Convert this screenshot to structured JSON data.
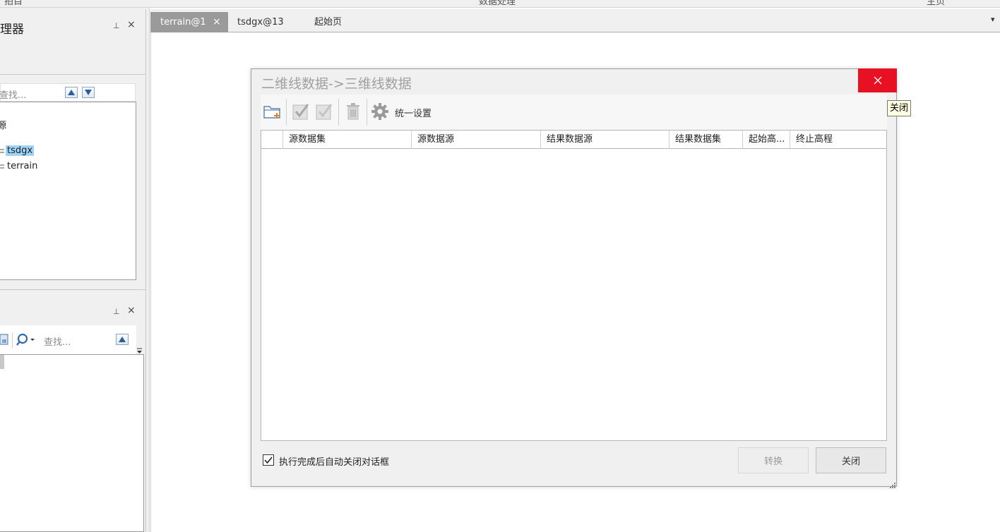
{
  "top_strip": {
    "left_text": "拍目",
    "center_text": "数据处理",
    "right_text": "主页"
  },
  "workspace_panel": {
    "title": "理器",
    "pin_glyph": "⊥",
    "close_glyph": "×",
    "search_placeholder": "查找...",
    "tree": [
      {
        "label": "源",
        "selected": false
      },
      {
        "label": "tsdgx",
        "selected": true
      },
      {
        "label": "terrain",
        "selected": false
      }
    ]
  },
  "layer_panel": {
    "pin_glyph": "⊥",
    "close_glyph": "×",
    "search_placeholder": "查找..."
  },
  "tabs": [
    {
      "label": "terrain@1",
      "active": true,
      "close_glyph": "×"
    },
    {
      "label": "tsdgx@13",
      "active": false
    },
    {
      "label": "起始页",
      "active": false
    }
  ],
  "tab_dropdown_glyph": "▾",
  "dialog": {
    "title": "二维线数据->三维线数据",
    "close_tooltip": "关闭",
    "toolbar": {
      "settings_label": "统一设置"
    },
    "columns": [
      "源数据集",
      "源数据源",
      "结果数据源",
      "结果数据集",
      "起始高...",
      "终止高程"
    ],
    "rows": [],
    "auto_close_label": "执行完成后自动关闭对话框",
    "auto_close_checked": true,
    "convert_button": "转换",
    "close_button": "关闭"
  },
  "colors": {
    "close_red": "#e81123",
    "selection_blue": "#9fd3f7",
    "active_tab": "#9a9a9a",
    "tooltip_bg": "#ffffe1"
  }
}
